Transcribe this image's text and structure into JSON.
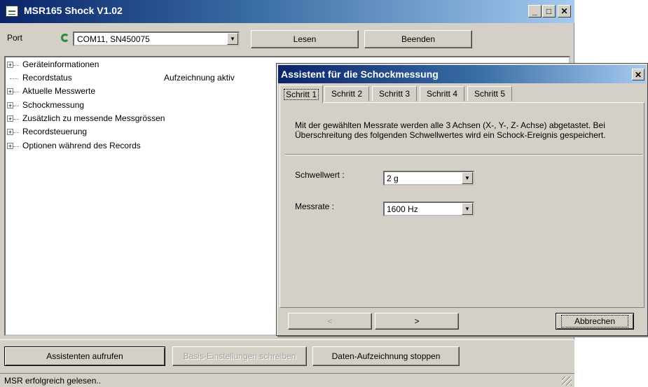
{
  "window": {
    "title": "MSR165 Shock V1.02",
    "min_glyph": "_",
    "max_glyph": "□",
    "close_glyph": "✕"
  },
  "toolbar": {
    "port_label": "Port",
    "port_value": "COM11, SN450075",
    "read_button": "Lesen",
    "exit_button": "Beenden"
  },
  "tree": {
    "items": [
      {
        "label": "Geräteinformationen",
        "expandable": true,
        "value": ""
      },
      {
        "label": "Recordstatus",
        "expandable": false,
        "value": "Aufzeichnung aktiv"
      },
      {
        "label": "Aktuelle Messwerte",
        "expandable": true,
        "value": ""
      },
      {
        "label": "Schockmessung",
        "expandable": true,
        "value": ""
      },
      {
        "label": "Zusätzlich zu messende Messgrössen",
        "expandable": true,
        "value": ""
      },
      {
        "label": "Recordsteuerung",
        "expandable": true,
        "value": ""
      },
      {
        "label": "Optionen während des Records",
        "expandable": true,
        "value": ""
      }
    ]
  },
  "bottom": {
    "assistant_button": "Assistenten aufrufen",
    "write_basic_button": "Basis-Einstellungen schreiben",
    "stop_button": "Daten-Aufzeichnung stoppen"
  },
  "status": {
    "text": "MSR erfolgreich gelesen.."
  },
  "dialog": {
    "title": "Assistent für die Schockmessung",
    "close_glyph": "✕",
    "tabs": [
      "Schritt 1",
      "Schritt 2",
      "Schritt 3",
      "Schritt 4",
      "Schritt 5"
    ],
    "active_tab": 0,
    "description_line1": "Mit der gewählten Messrate werden alle 3 Achsen (X-, Y-, Z- Achse) abgetastet. Bei",
    "description_line2": "Überschreitung des folgenden Schwellwertes wird ein Schock-Ereignis gespeichert.",
    "threshold_label": "Schwellwert :",
    "threshold_value": "2 g",
    "rate_label": "Messrate :",
    "rate_value": "1600 Hz",
    "back_button": "<",
    "next_button": ">",
    "cancel_button": "Abbrechen"
  }
}
